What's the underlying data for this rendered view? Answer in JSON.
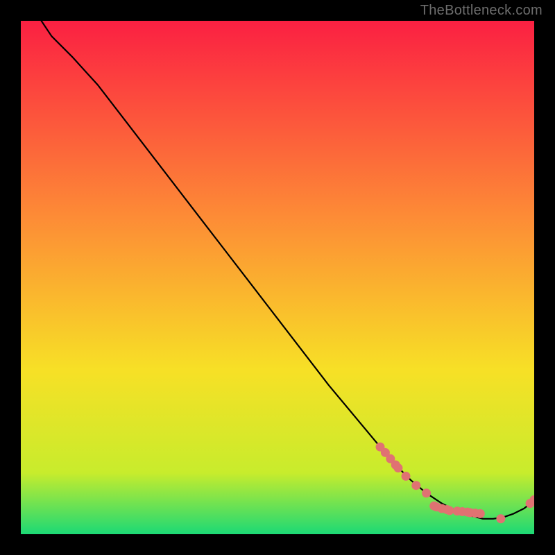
{
  "watermark": "TheBottleneck.com",
  "colors": {
    "gradient_top": "#fb2042",
    "gradient_mid1": "#fd8b36",
    "gradient_mid2": "#f7e026",
    "gradient_mid3": "#c8ec2c",
    "gradient_bottom": "#1cd975",
    "curve": "#000000",
    "marker": "#e07272",
    "background": "#000000"
  },
  "chart_data": {
    "type": "line",
    "title": "",
    "xlabel": "",
    "ylabel": "",
    "xlim": [
      0,
      100
    ],
    "ylim": [
      0,
      100
    ],
    "curve": {
      "x": [
        4,
        6,
        10,
        15,
        20,
        25,
        30,
        35,
        40,
        45,
        50,
        55,
        60,
        65,
        70,
        73,
        76,
        79,
        82,
        85,
        88,
        90,
        92,
        94,
        96,
        98,
        100
      ],
      "y": [
        100,
        97,
        93,
        87.5,
        81,
        74.5,
        68,
        61.5,
        55,
        48.5,
        42,
        35.5,
        29,
        23,
        17,
        13.5,
        10.5,
        8,
        6,
        4.5,
        3.5,
        3,
        3,
        3.3,
        4,
        5,
        6.5
      ]
    },
    "markers": [
      {
        "x": 70,
        "y": 17.0
      },
      {
        "x": 71,
        "y": 15.9
      },
      {
        "x": 72,
        "y": 14.7
      },
      {
        "x": 73,
        "y": 13.5
      },
      {
        "x": 73.5,
        "y": 12.9
      },
      {
        "x": 75,
        "y": 11.3
      },
      {
        "x": 77,
        "y": 9.5
      },
      {
        "x": 79,
        "y": 8.0
      },
      {
        "x": 80.5,
        "y": 5.5
      },
      {
        "x": 81,
        "y": 5.3
      },
      {
        "x": 82,
        "y": 5.0
      },
      {
        "x": 83,
        "y": 4.8
      },
      {
        "x": 83.5,
        "y": 4.6
      },
      {
        "x": 85,
        "y": 4.5
      },
      {
        "x": 86,
        "y": 4.4
      },
      {
        "x": 87,
        "y": 4.3
      },
      {
        "x": 87.5,
        "y": 4.2
      },
      {
        "x": 88.5,
        "y": 4.1
      },
      {
        "x": 89.5,
        "y": 4.0
      },
      {
        "x": 93.5,
        "y": 3.0
      },
      {
        "x": 99.2,
        "y": 6.0
      },
      {
        "x": 100,
        "y": 6.7
      }
    ]
  }
}
